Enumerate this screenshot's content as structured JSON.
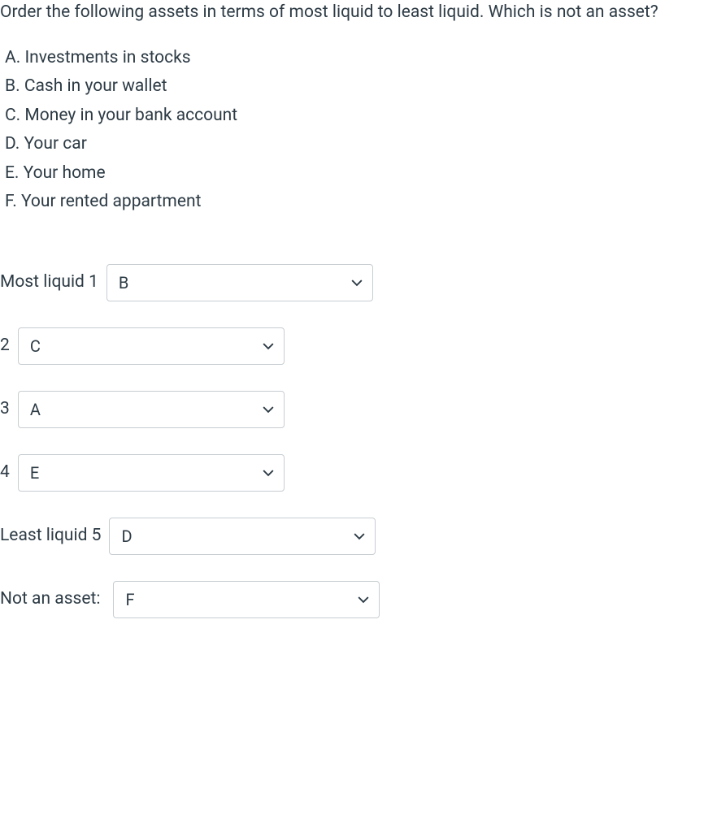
{
  "question": {
    "text": "Order the following assets in terms of most liquid to least liquid. Which is not an asset?",
    "options": [
      "A. Investments in stocks",
      "B. Cash in your wallet",
      "C. Money in your bank account",
      "D. Your car",
      "E. Your home",
      "F. Your rented appartment"
    ]
  },
  "answers": {
    "row1": {
      "label": "Most liquid 1",
      "value": "B"
    },
    "row2": {
      "label": "2",
      "value": "C"
    },
    "row3": {
      "label": "3",
      "value": "A"
    },
    "row4": {
      "label": "4",
      "value": "E"
    },
    "row5": {
      "label": "Least liquid 5",
      "value": "D"
    },
    "row6": {
      "label": "Not an asset:",
      "value": "F"
    }
  }
}
